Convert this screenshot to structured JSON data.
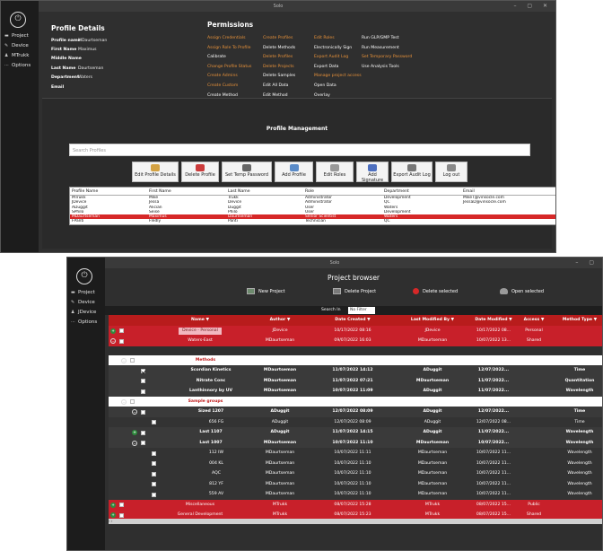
{
  "win1": {
    "title": "Solo",
    "sidebar": [
      {
        "icon": "folder-icon",
        "label": "Project"
      },
      {
        "icon": "device-icon",
        "label": "Device"
      },
      {
        "icon": "user-icon",
        "label": "MTrukk"
      },
      {
        "icon": "more-icon",
        "label": "Options"
      }
    ],
    "profile_details": {
      "title": "Profile Details",
      "fields": [
        {
          "k": "Profile name",
          "v": "MDaurtseman"
        },
        {
          "k": "First Name",
          "v": "Maximus"
        },
        {
          "k": "Middle Name",
          "v": ""
        },
        {
          "k": "Last Name",
          "v": "Daurtseman"
        },
        {
          "k": "Department",
          "v": "Waters"
        },
        {
          "k": "Email",
          "v": ""
        }
      ]
    },
    "permissions": {
      "title": "Permissions",
      "cols": [
        [
          {
            "t": "Assign Credentials",
            "on": true
          },
          {
            "t": "Assign Role To Profile",
            "on": true
          },
          {
            "t": "Calibrate",
            "on": false
          },
          {
            "t": "Change Profile Status",
            "on": true
          },
          {
            "t": "Create Admins",
            "on": true
          },
          {
            "t": "Create Custom",
            "on": true
          },
          {
            "t": "Create Method",
            "on": false
          }
        ],
        [
          {
            "t": "Create Profiles",
            "on": true
          },
          {
            "t": "Delete Methods",
            "on": false
          },
          {
            "t": "Delete Profiles",
            "on": true
          },
          {
            "t": "Delete Projects",
            "on": true
          },
          {
            "t": "Delete Samples",
            "on": false
          },
          {
            "t": "Edit All Data",
            "on": false
          },
          {
            "t": "Edit Method",
            "on": false
          }
        ],
        [
          {
            "t": "Edit Roles",
            "on": true
          },
          {
            "t": "Electronically Sign",
            "on": false
          },
          {
            "t": "Export Audit Log",
            "on": true
          },
          {
            "t": "Export Data",
            "on": false
          },
          {
            "t": "Manage project access",
            "on": true
          },
          {
            "t": "Open Data",
            "on": false
          },
          {
            "t": "Overlay",
            "on": false
          }
        ],
        [
          {
            "t": "Run GLP/GMP Test",
            "on": false
          },
          {
            "t": "Run Measurement",
            "on": false
          },
          {
            "t": "Set Temporary Password",
            "on": true
          },
          {
            "t": "Use Analysis Tools",
            "on": false
          }
        ]
      ]
    },
    "profile_management": {
      "title": "Profile Management",
      "search_placeholder": "Search Profiles",
      "buttons": [
        "Edit Profile Details",
        "Delete Profile",
        "Set Temp Password",
        "Add Profile",
        "Edit Roles",
        "Add Signature",
        "Export Audit Log",
        "Log out"
      ],
      "columns": [
        "Profile Name",
        "First Name",
        "Last Name",
        "Role",
        "Department",
        "Email"
      ],
      "rows": [
        [
          "MTrukk",
          "Mike",
          "Trukk",
          "Administrator",
          "Development",
          "MikeT@vinsocle.com"
        ],
        [
          "JDevice",
          "Jessa",
          "Device",
          "Administrator",
          "QC",
          "JessaD@vinsocle.com"
        ],
        [
          "ADuggit",
          "Alician",
          "Duggit",
          "User",
          "Waters",
          ""
        ],
        [
          "SPhilo",
          "Seise",
          "Philo",
          "User",
          "Development",
          ""
        ],
        [
          "MDaurtseman",
          "Maximus",
          "Daurtseman",
          "Senior Scientist",
          "Waters",
          ""
        ],
        [
          "FPanti",
          "Fledly",
          "Panti",
          "Technician",
          "QC",
          ""
        ]
      ],
      "selected_row": 4
    }
  },
  "win2": {
    "title": "Solo",
    "sidebar": [
      {
        "icon": "folder-icon",
        "label": "Project"
      },
      {
        "icon": "device-icon",
        "label": "Device"
      },
      {
        "icon": "user-icon",
        "label": "JDevice"
      },
      {
        "icon": "more-icon",
        "label": "Options"
      }
    ],
    "header": "Project browser",
    "actions": [
      "New Project",
      "Delete Project",
      "Delete selected",
      "Open selected"
    ],
    "search_label": "Search In",
    "search_value": "No Filter",
    "columns": [
      "Name",
      "Author",
      "Date Created",
      "Last Modified By",
      "Date Modified",
      "Access",
      "Method Type"
    ],
    "rows": [
      {
        "kind": "red",
        "tog": "g",
        "cb": true,
        "tag": true,
        "cells": [
          "Device - Personal",
          "JDevice",
          "10/17/2022 08:16",
          "JDevice",
          "10/17/2022 08...",
          "Personal",
          ""
        ]
      },
      {
        "kind": "red",
        "tog": "o",
        "cb": true,
        "cells": [
          "Waters-East",
          "MDaurtseman",
          "09/07/2022 16:03",
          "MDaurtseman",
          "10/07/2022 13...",
          "Shared",
          ""
        ]
      },
      {
        "kind": "gap"
      },
      {
        "kind": "white",
        "indent": 1,
        "tog": "o",
        "cb": true,
        "cells": [
          "Methods",
          "",
          "",
          "",
          "",
          "",
          ""
        ]
      },
      {
        "kind": "dark",
        "b": true,
        "indent": 2,
        "cbChk": true,
        "cells": [
          "Scordian Kinetics",
          "MDaurtseman",
          "11/07/2022 14:12",
          "ADuggit",
          "12/07/2022...",
          "",
          "Time"
        ]
      },
      {
        "kind": "dark",
        "b": true,
        "indent": 2,
        "cb": true,
        "cells": [
          "Nitrate Conc",
          "MDaurtseman",
          "11/07/2022 07:21",
          "MDaurtseman",
          "11/07/2022...",
          "",
          "Quantitation"
        ]
      },
      {
        "kind": "dark",
        "b": true,
        "indent": 2,
        "cb": true,
        "cells": [
          "Lanthinnory by UV",
          "MDaurtseman",
          "10/07/2022 11:09",
          "ADuggit",
          "11/07/2022...",
          "",
          "Wavelength"
        ]
      },
      {
        "kind": "white",
        "indent": 1,
        "tog": "o",
        "cb": true,
        "cells": [
          "Sample groups",
          "",
          "",
          "",
          "",
          "",
          ""
        ]
      },
      {
        "kind": "dark",
        "b": true,
        "indent": 2,
        "tog": "o",
        "cb": true,
        "cells": [
          "Sized 1207",
          "ADuggit",
          "12/07/2022 08:09",
          "ADuggit",
          "12/07/2022...",
          "",
          "Time"
        ]
      },
      {
        "kind": "dark2",
        "indent": 3,
        "cb": true,
        "cells": [
          "656 FG",
          "ADuggit",
          "12/07/2022 08:09",
          "ADuggit",
          "12/07/2022 08...",
          "",
          "Time"
        ]
      },
      {
        "kind": "dark",
        "b": true,
        "indent": 2,
        "tog": "g",
        "cb": true,
        "cells": [
          "Last 1107",
          "ADuggit",
          "11/07/2022 14:15",
          "ADuggit",
          "11/07/2022...",
          "",
          "Wavelength"
        ]
      },
      {
        "kind": "dark",
        "b": true,
        "indent": 2,
        "tog": "o",
        "cb": true,
        "cells": [
          "Last 1007",
          "MDaurtseman",
          "10/07/2022 11:10",
          "MDaurtseman",
          "10/07/2022...",
          "",
          "Wavelength"
        ]
      },
      {
        "kind": "dark2",
        "indent": 3,
        "cb": true,
        "cells": [
          "112 IW",
          "MDaurtseman",
          "10/07/2022 11:11",
          "MDaurtseman",
          "10/07/2022 11...",
          "",
          "Wavelength"
        ]
      },
      {
        "kind": "dark2",
        "indent": 3,
        "cb": true,
        "cells": [
          "004 KL",
          "MDaurtseman",
          "10/07/2022 11:10",
          "MDaurtseman",
          "10/07/2022 11...",
          "",
          "Wavelength"
        ]
      },
      {
        "kind": "dark2",
        "indent": 3,
        "cb": true,
        "cells": [
          "AQC",
          "MDaurtseman",
          "10/07/2022 11:10",
          "MDaurtseman",
          "10/07/2022 11...",
          "",
          "Wavelength"
        ]
      },
      {
        "kind": "dark2",
        "indent": 3,
        "cb": true,
        "cells": [
          "812 YF",
          "MDaurtseman",
          "10/07/2022 11:10",
          "MDaurtseman",
          "10/07/2022 11...",
          "",
          "Wavelength"
        ]
      },
      {
        "kind": "dark2",
        "indent": 3,
        "cb": true,
        "cells": [
          "559 AV",
          "MDaurtseman",
          "10/07/2022 11:10",
          "MDaurtseman",
          "10/07/2022 11...",
          "",
          "Wavelength"
        ]
      },
      {
        "kind": "red",
        "tog": "g",
        "cb": true,
        "cells": [
          "Miscellaneous",
          "MTrukk",
          "08/07/2022 15:28",
          "MTrukk",
          "08/07/2022 15...",
          "Public",
          ""
        ]
      },
      {
        "kind": "red",
        "tog": "g",
        "cb": true,
        "cells": [
          "General Development",
          "MTrukk",
          "08/07/2022 15:23",
          "MTrukk",
          "08/07/2022 15...",
          "Shared",
          ""
        ]
      }
    ]
  }
}
